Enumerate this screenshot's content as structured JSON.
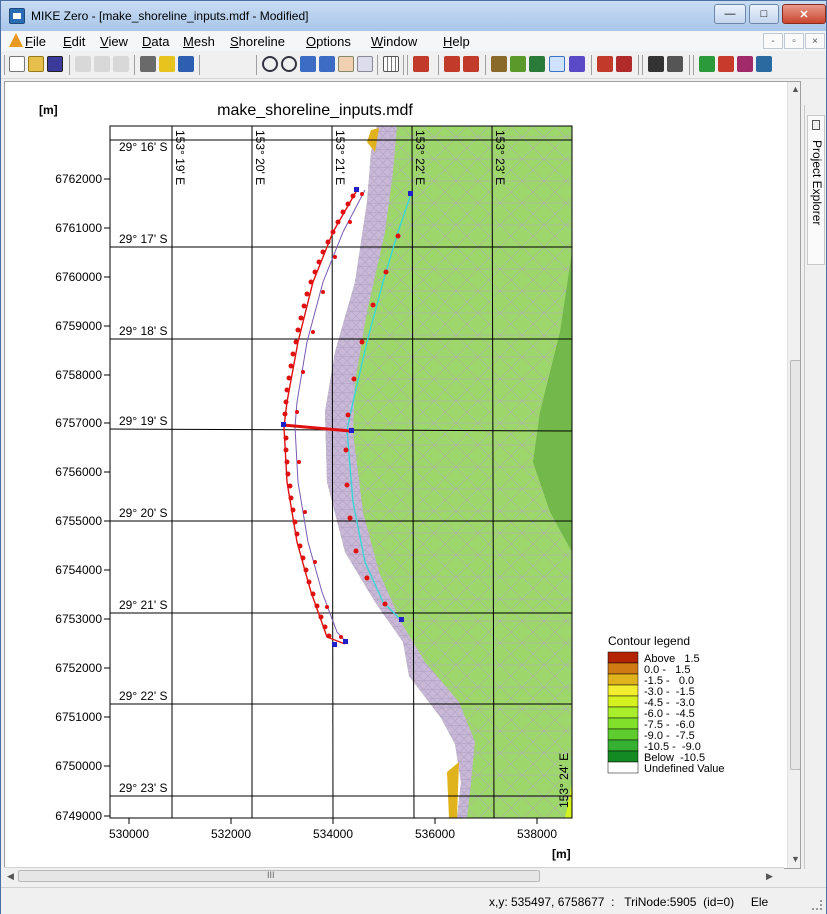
{
  "window": {
    "title": "MIKE Zero - [make_shoreline_inputs.mdf - Modified]",
    "minimize_symbol": "—",
    "maximize_symbol": "□",
    "close_symbol": "✕"
  },
  "menu": {
    "items": [
      "File",
      "Edit",
      "View",
      "Data",
      "Mesh",
      "Shoreline",
      "Options",
      "Window",
      "Help"
    ],
    "mdi_controls": [
      "-",
      "▫",
      "×"
    ]
  },
  "toolbar": {
    "icons": [
      "new-icon",
      "open-icon",
      "save-icon",
      "cut-icon",
      "copy-icon",
      "paste-icon",
      "print-icon",
      "help-icon",
      "context-help-icon",
      "zoom-in-icon",
      "zoom-out-icon",
      "zoom-previous-icon",
      "zoom-next-icon",
      "pan-icon",
      "show-all-icon",
      "grid-icon",
      "select-icon",
      "point-tool-icon",
      "arc-tool-icon",
      "draw-line-icon",
      "check-icon",
      "edit-line-icon",
      "selected-tool-icon",
      "link-icon",
      "arrow-tool-icon",
      "pen-icon",
      "find-icon",
      "properties-icon",
      "nodes-icon",
      "points-icon",
      "delete-points-icon",
      "extra-icon"
    ]
  },
  "map": {
    "title": "make_shoreline_inputs.mdf",
    "x_unit_label": "[m]",
    "y_unit_label": "[m]",
    "x_ticks": [
      "530000",
      "532000",
      "534000",
      "536000",
      "538000"
    ],
    "y_ticks": [
      "6762000",
      "6761000",
      "6760000",
      "6759000",
      "6758000",
      "6757000",
      "6756000",
      "6755000",
      "6754000",
      "6753000",
      "6752000",
      "6751000",
      "6750000",
      "6749000"
    ],
    "lat_labels": [
      "29° 16' S",
      "29° 17' S",
      "29° 18' S",
      "29° 19' S",
      "29° 20' S",
      "29° 21' S",
      "29° 22' S",
      "29° 23' S"
    ],
    "lon_labels": [
      "153° 19' E",
      "153° 20' E",
      "153° 21' E",
      "153° 22' E",
      "153° 23' E"
    ],
    "lon_label_bottom": "153° 24' E",
    "colors": {
      "water": "#9dd66a",
      "deep": "#73b84a",
      "mesh": "#b5a6c7",
      "red_line": "#e01010",
      "cyan_line": "#3ad6d6",
      "node": "#2020c8"
    }
  },
  "legend": {
    "title": "Contour legend",
    "entries": [
      {
        "label": "Above   1.5",
        "color": "#b32400"
      },
      {
        "label": "0.0 -   1.5",
        "color": "#d07a14"
      },
      {
        "label": "-1.5 -   0.0",
        "color": "#e0b21c"
      },
      {
        "label": "-3.0 -  -1.5",
        "color": "#f2ee2e"
      },
      {
        "label": "-4.5 -  -3.0",
        "color": "#d5f220"
      },
      {
        "label": "-6.0 -  -4.5",
        "color": "#a8ee2a"
      },
      {
        "label": "-7.5 -  -6.0",
        "color": "#80e02a"
      },
      {
        "label": "-9.0 -  -7.5",
        "color": "#5ecc2c"
      },
      {
        "label": "-10.5 -  -9.0",
        "color": "#36b030"
      },
      {
        "label": "Below  -10.5",
        "color": "#138a22"
      },
      {
        "label": "Undefined Value",
        "color": "#ffffff"
      }
    ]
  },
  "side_panel": {
    "label": "Project Explorer"
  },
  "status": {
    "text": "x,y: 535497, 6758677  :   TriNode:5905  (id=0)     Ele"
  },
  "scroll": {
    "down_arrow": "▼",
    "up_arrow": "▲",
    "left_arrow": "◀",
    "right_arrow": "▶",
    "thumb_marks": "III"
  }
}
